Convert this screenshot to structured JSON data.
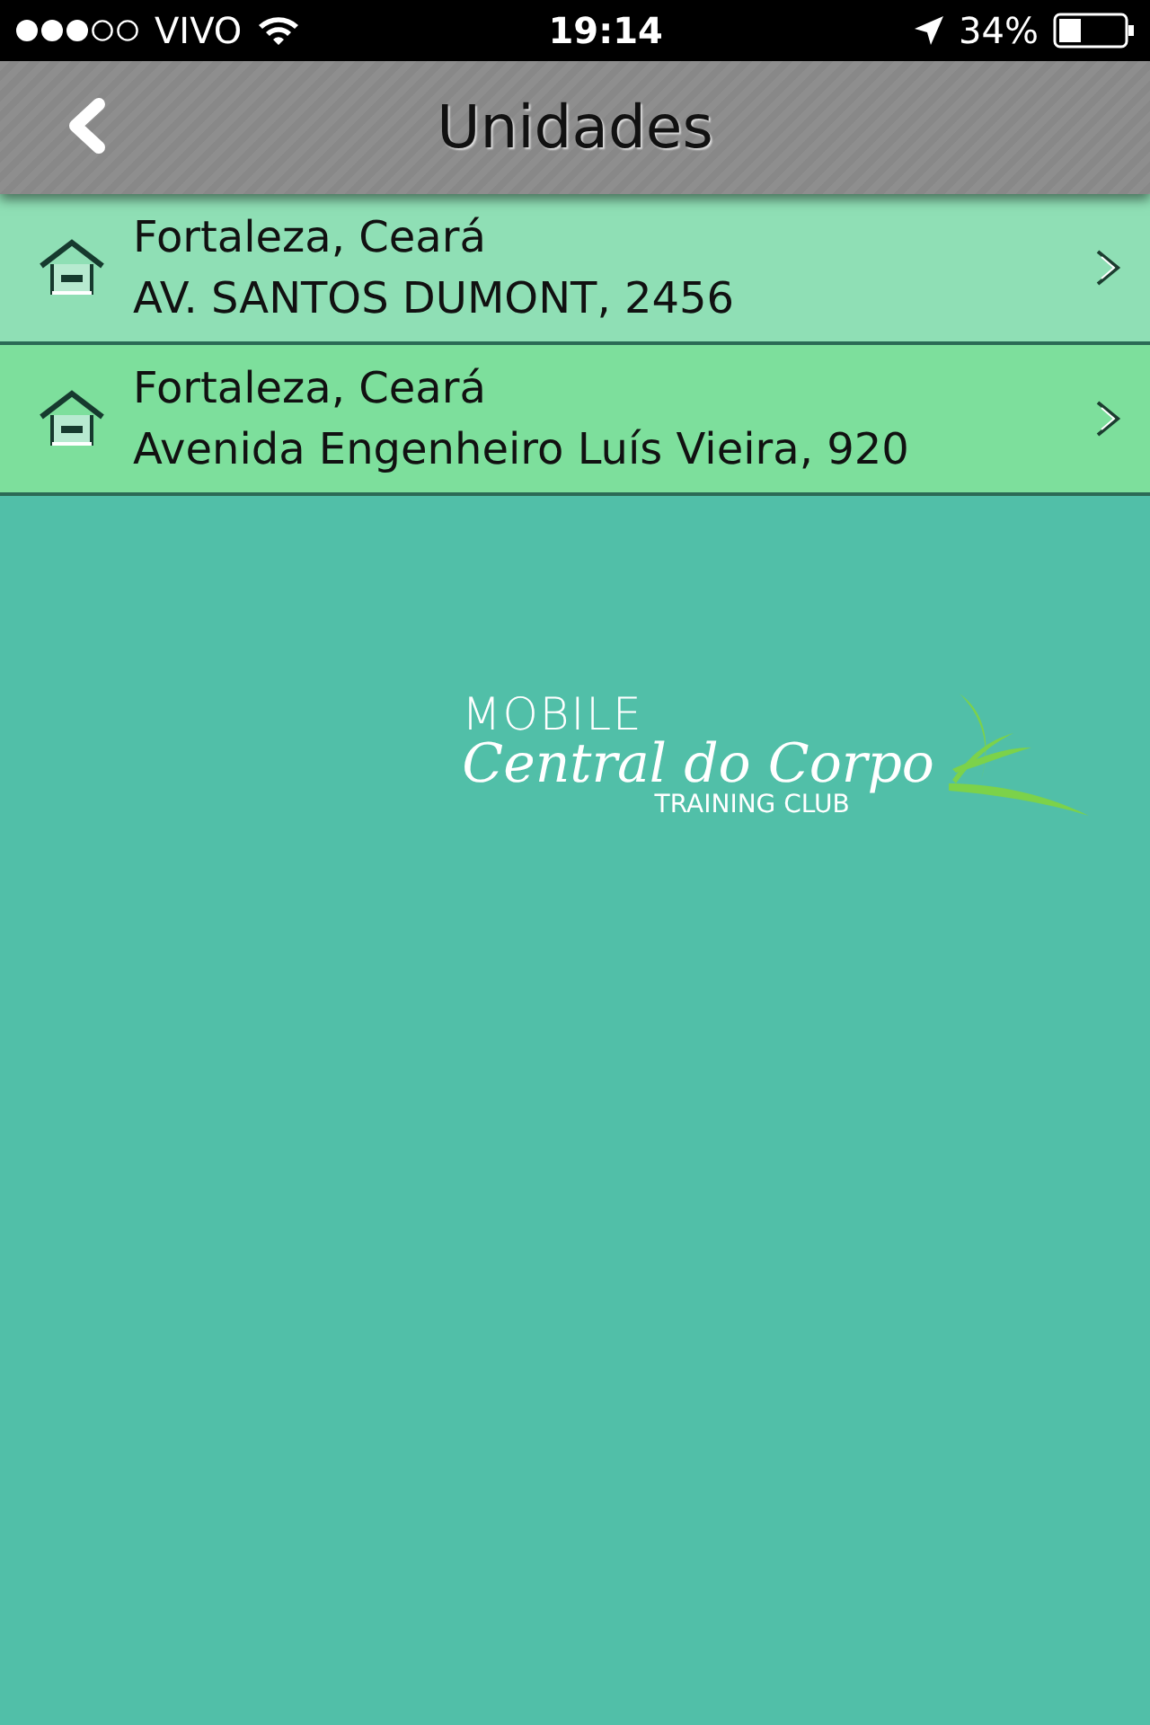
{
  "status_bar": {
    "carrier": "VIVO",
    "time": "19:14",
    "battery": "34%"
  },
  "nav": {
    "title": "Unidades"
  },
  "units": [
    {
      "city": "Fortaleza, Ceará",
      "address": "AV. SANTOS DUMONT, 2456",
      "color": "#8fdfb5"
    },
    {
      "city": "Fortaleza, Ceará",
      "address": "Avenida Engenheiro Luís Vieira, 920",
      "color": "#7ddf9c"
    }
  ],
  "logo": {
    "top": "MOBILE",
    "main": "Central do Corpo",
    "bottom": "TRAINING CLUB"
  }
}
